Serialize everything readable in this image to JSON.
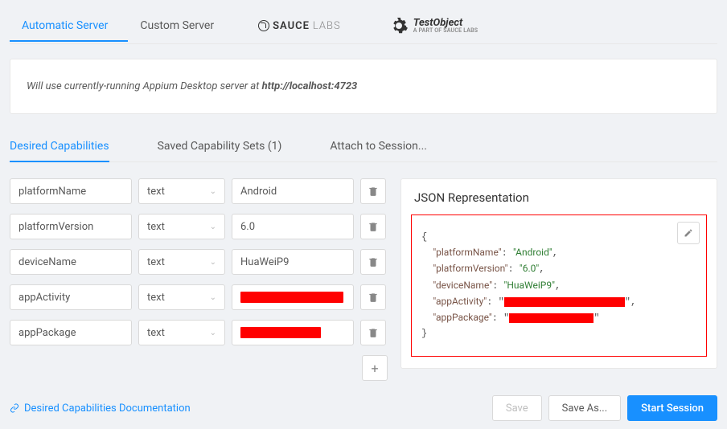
{
  "server_tabs": {
    "automatic": "Automatic Server",
    "custom": "Custom Server",
    "sauce": "SAUCE",
    "sauce_suffix": "LABS",
    "testobject": "TestObject",
    "testobject_sub": "A PART OF SAUCE LABS"
  },
  "server_info": {
    "prefix": "Will use currently-running Appium Desktop server at ",
    "url": "http://localhost:4723"
  },
  "cap_tabs": {
    "desired": "Desired Capabilities",
    "saved": "Saved Capability Sets (1)",
    "attach": "Attach to Session..."
  },
  "caps": [
    {
      "name": "platformName",
      "type": "text",
      "value": "Android",
      "redacted": false
    },
    {
      "name": "platformVersion",
      "type": "text",
      "value": "6.0",
      "redacted": false
    },
    {
      "name": "deviceName",
      "type": "text",
      "value": "HuaWeiP9",
      "redacted": false
    },
    {
      "name": "appActivity",
      "type": "text",
      "value": "",
      "redacted": true,
      "redact_w": 128
    },
    {
      "name": "appPackage",
      "type": "text",
      "value": "",
      "redacted": true,
      "redact_w": 100
    }
  ],
  "json": {
    "title": "JSON Representation",
    "lines": [
      {
        "t": "{",
        "plain": true
      },
      {
        "k": "platformName",
        "v": "Android",
        "comma": true
      },
      {
        "k": "platformVersion",
        "v": "6.0",
        "comma": true
      },
      {
        "k": "deviceName",
        "v": "HuaWeiP9",
        "comma": true
      },
      {
        "k": "appActivity",
        "redacted": true,
        "rw": 150,
        "comma": true
      },
      {
        "k": "appPackage",
        "redacted": true,
        "rw": 105,
        "comma": false
      },
      {
        "t": "}",
        "plain": true
      }
    ]
  },
  "footer": {
    "doc": "Desired Capabilities Documentation",
    "save": "Save",
    "saveas": "Save As...",
    "start": "Start Session"
  },
  "icons": {
    "add": "+"
  }
}
